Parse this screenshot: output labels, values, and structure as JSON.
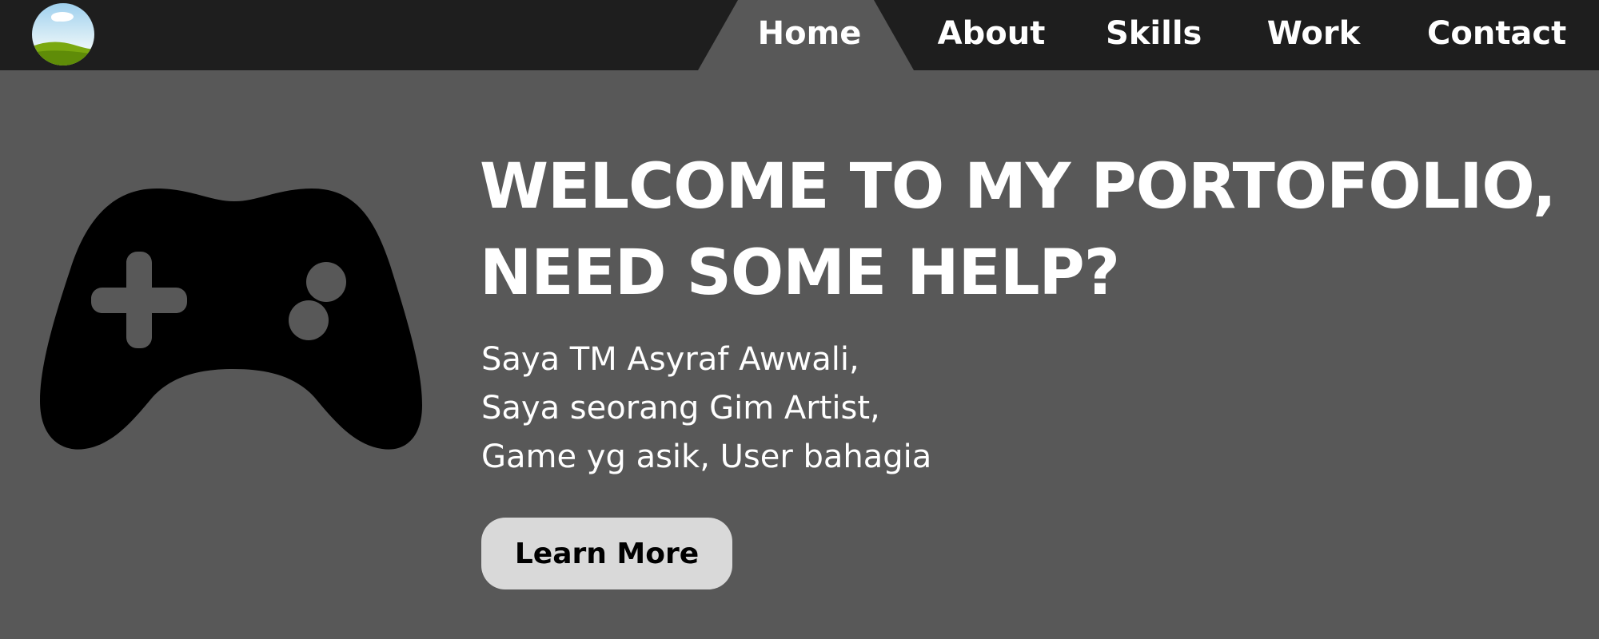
{
  "nav": {
    "logo_icon": "landscape-avatar-icon",
    "active_bg_color": "#585858",
    "items": [
      {
        "label": "Home",
        "active": true
      },
      {
        "label": "About",
        "active": false
      },
      {
        "label": "Skills",
        "active": false
      },
      {
        "label": "Work",
        "active": false
      },
      {
        "label": "Contact",
        "active": false
      }
    ]
  },
  "hero": {
    "icon": "gamepad-icon",
    "headline_line1": "WELCOME TO MY PORTOFOLIO,",
    "headline_line2": "NEED SOME HELP?",
    "intro_lines": [
      "Saya TM Asyraf Awwali,",
      "Saya seorang Gim Artist,",
      "Game yg asik, User bahagia"
    ],
    "button_label": "Learn More"
  },
  "colors": {
    "nav_background": "#1e1e1e",
    "page_background": "#585858",
    "text": "#ffffff",
    "button_background": "#d9d9d9",
    "button_text": "#000000"
  }
}
